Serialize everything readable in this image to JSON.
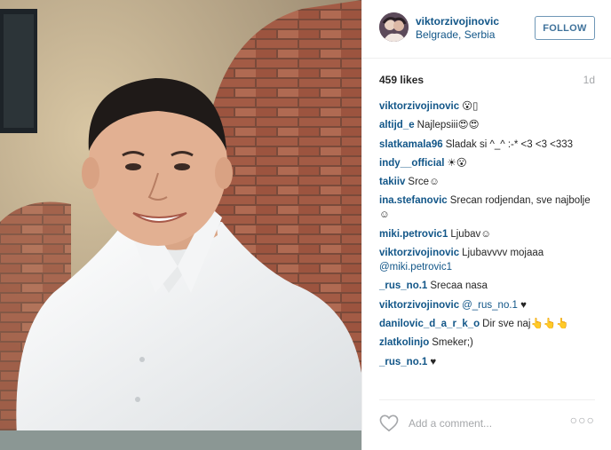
{
  "post": {
    "username": "viktorzivojinovic",
    "location": "Belgrade, Serbia",
    "follow_label": "FOLLOW",
    "likes": "459 likes",
    "age": "1d"
  },
  "comments": [
    {
      "user": "viktorzivojinovic",
      "text": "😮▯"
    },
    {
      "user": "altijd_e",
      "text": "Najlepsiii😍😍"
    },
    {
      "user": "slatkamala96",
      "text": "Sladak si ^_^ :-* <3 <3 <333"
    },
    {
      "user": "indy__official",
      "text": "☀😮"
    },
    {
      "user": "takiiv",
      "text": "Srce☺"
    },
    {
      "user": "ina.stefanovic",
      "text": "Srecan rodjendan, sve najbolje☺"
    },
    {
      "user": "miki.petrovic1",
      "text": "Ljubav☺"
    },
    {
      "user": "viktorzivojinovic",
      "text": "Ljubavvvv mojaaa",
      "mention": "@miki.petrovic1"
    },
    {
      "user": "_rus_no.1",
      "text": "Srecaa nasa"
    },
    {
      "user": "viktorzivojinovic",
      "mention": "@_rus_no.1",
      "text": "♥"
    },
    {
      "user": "danilovic_d_a_r_k_o",
      "text": "Dir sve naj👆👆👆"
    },
    {
      "user": "zlatkolinjo",
      "text": "Smeker;)"
    },
    {
      "user": "_rus_no.1",
      "text": "♥"
    }
  ],
  "footer": {
    "add_comment_placeholder": "Add a comment...",
    "more_label": "○○○"
  },
  "colors": {
    "link": "#125688",
    "follow_border": "#6f97b6",
    "muted": "#a5a7aa"
  },
  "icons": {
    "heart": "heart-outline-icon",
    "more": "more-options-icon"
  }
}
